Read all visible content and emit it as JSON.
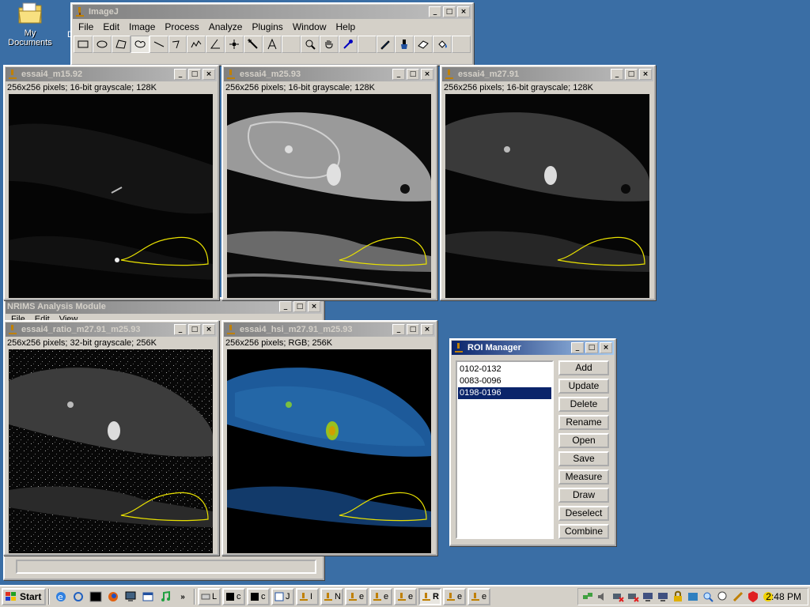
{
  "desktop": {
    "icon_label": "My Documents",
    "second_icon_label": "D"
  },
  "imagej": {
    "title": "ImageJ",
    "menus": [
      "File",
      "Edit",
      "Image",
      "Process",
      "Analyze",
      "Plugins",
      "Window",
      "Help"
    ],
    "tools": [
      "rectangle-tool",
      "oval-tool",
      "polygon-tool",
      "freehand-tool",
      "straight-line-tool",
      "segmented-line-tool",
      "freehand-line-tool",
      "angle-tool",
      "point-tool",
      "wand-tool",
      "text-tool",
      "spacer",
      "magnifier-tool",
      "hand-tool",
      "color-picker-tool",
      "spacer",
      "pencil-tool",
      "brush-tool",
      "eraser-tool",
      "flood-fill-tool",
      "spacer"
    ]
  },
  "windows": {
    "w1": {
      "title": "essai4_m15.92",
      "info": "256x256 pixels; 16-bit grayscale; 128K"
    },
    "w2": {
      "title": "essai4_m25.93",
      "info": "256x256 pixels; 16-bit grayscale; 128K"
    },
    "w3": {
      "title": "essai4_m27.91",
      "info": "256x256 pixels; 16-bit grayscale; 128K"
    },
    "w4": {
      "title": "essai4_ratio_m27.91_m25.93",
      "info": "256x256 pixels; 32-bit grayscale; 256K"
    },
    "w5": {
      "title": "essai4_hsi_m27.91_m25.93",
      "info": "256x256 pixels; RGB; 256K"
    }
  },
  "nrims": {
    "title": "NRIMS Analysis Module",
    "menus": [
      "File",
      "Edit",
      "View"
    ]
  },
  "roi_manager": {
    "title": "ROI Manager",
    "items": [
      "0102-0132",
      "0083-0096",
      "0198-0196"
    ],
    "selected_index": 2,
    "buttons": [
      "Add",
      "Update",
      "Delete",
      "Rename",
      "Open",
      "Save",
      "Measure",
      "Draw",
      "Deselect",
      "Combine"
    ]
  },
  "taskbar": {
    "start_label": "Start",
    "tasks": [
      "L",
      "c",
      "c",
      "J",
      "I",
      "N",
      "e",
      "e",
      "e",
      "R",
      "e",
      "e"
    ],
    "active_task_index": 9,
    "clock": "2:48 PM"
  },
  "colors": {
    "desktop": "#3a6ea5",
    "title_active": "#0a246a",
    "roi_outline": "#e8e000",
    "chrome": "#d4d0c8"
  }
}
